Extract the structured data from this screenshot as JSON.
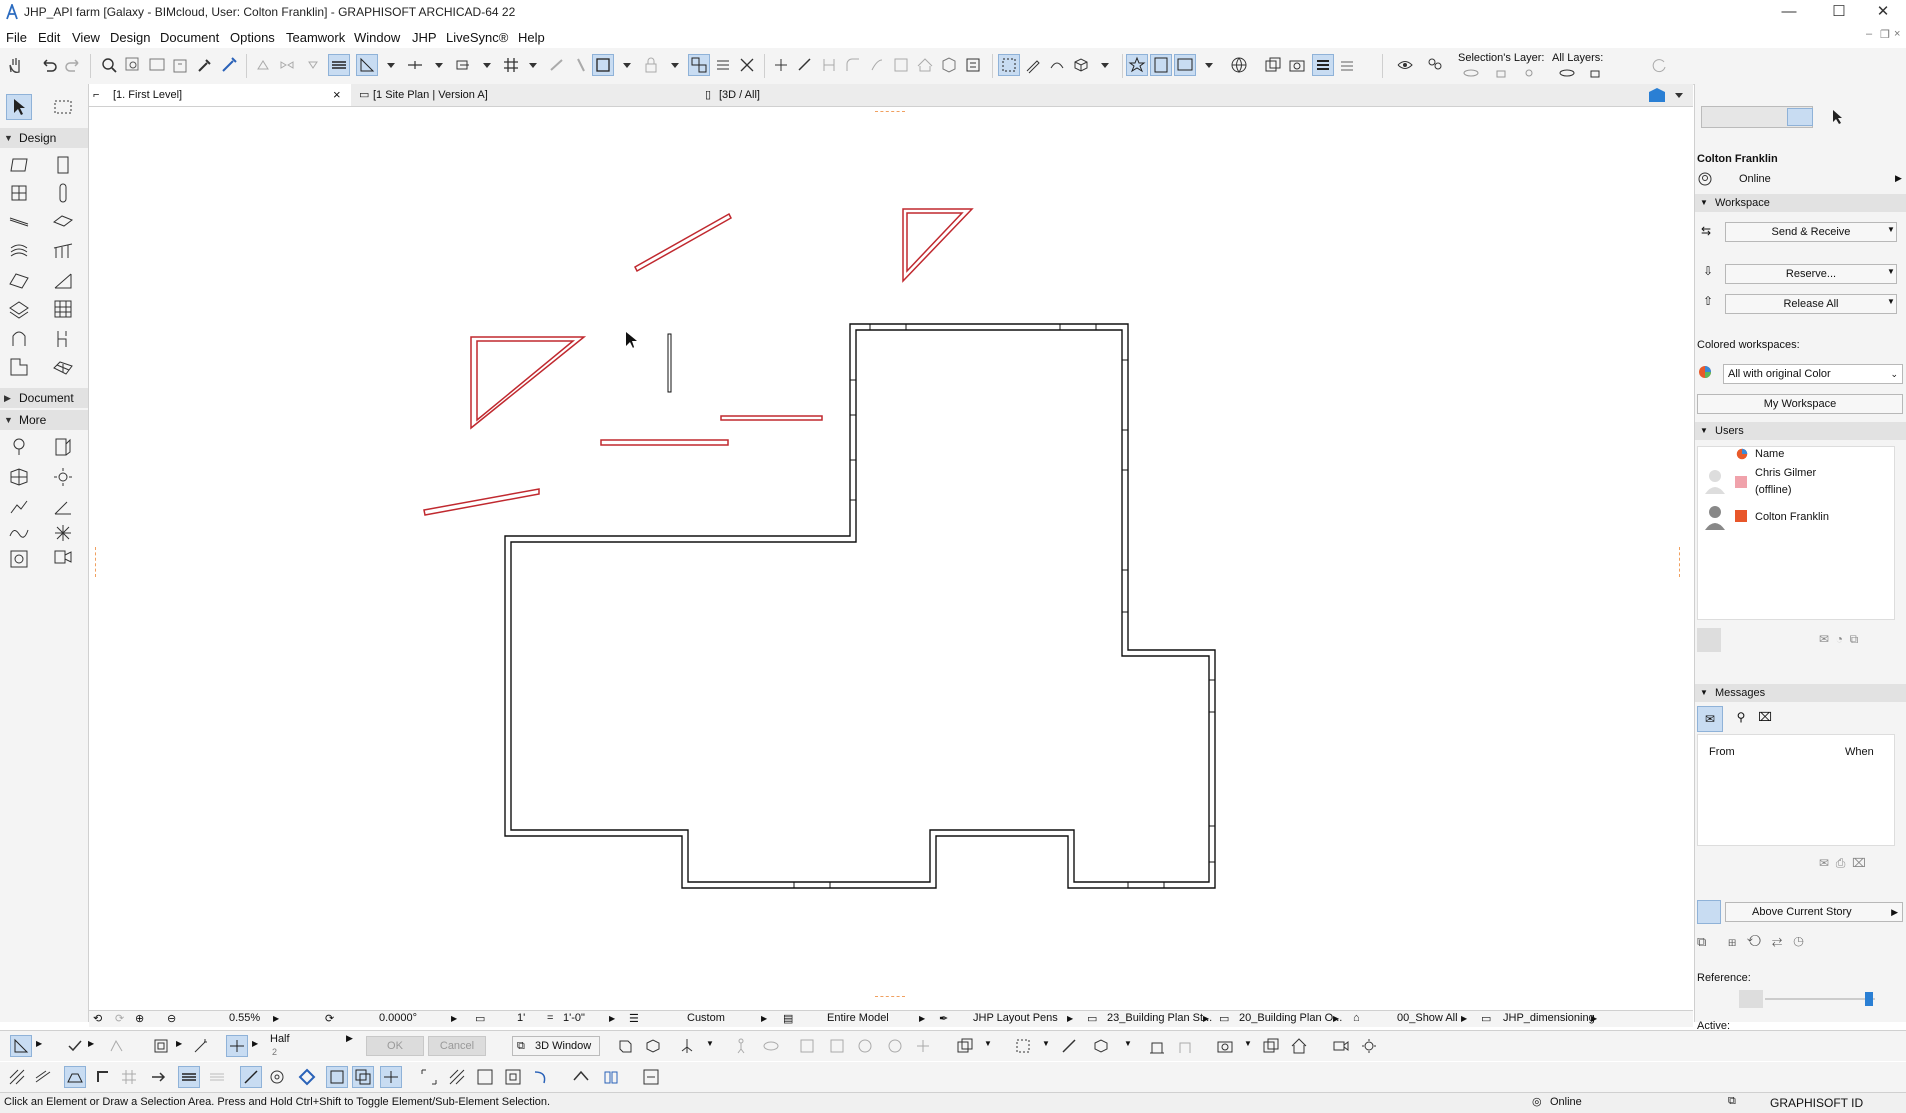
{
  "window": {
    "title": "JHP_API farm [Galaxy - BIMcloud, User: Colton Franklin] - GRAPHISOFT ARCHICAD-64 22",
    "min": "—",
    "max": "☐",
    "close": "✕"
  },
  "menu": [
    "File",
    "Edit",
    "View",
    "Design",
    "Document",
    "Options",
    "Teamwork",
    "Window",
    "JHP",
    "LiveSync®",
    "Help"
  ],
  "toolbar": {
    "selection_layer_label": "Selection's Layer:",
    "all_layers_label": "All Layers:"
  },
  "toolbox": {
    "design": "Design",
    "document": "Document",
    "more": "More"
  },
  "tabs": [
    {
      "label": "[1. First Level]",
      "close": "×"
    },
    {
      "label": "[1 Site Plan | Version A]"
    },
    {
      "label": "[3D / All]"
    }
  ],
  "panel": {
    "user": "Colton Franklin",
    "status": "Online",
    "workspace": "Workspace",
    "send_receive": "Send & Receive",
    "reserve": "Reserve...",
    "release_all": "Release All",
    "colored_label": "Colored workspaces:",
    "colored_value": "All with original Color",
    "my_workspace": "My Workspace",
    "users": "Users",
    "name_col": "Name",
    "user1_name": "Chris Gilmer",
    "user1_status": "(offline)",
    "user2_name": "Colton Franklin",
    "messages": "Messages",
    "from_col": "From",
    "when_col": "When",
    "trace_value": "Above Current Story",
    "reference": "Reference:",
    "active": "Active:",
    "colors": {
      "user1": "#f0a2ab",
      "user2": "#e8562a"
    }
  },
  "navbar": {
    "zoom": "0.55%",
    "angle": "0.0000°",
    "scale_a": "1'",
    "scale_eq": "=",
    "scale_b": "1'-0\"",
    "layer_combo": "Custom",
    "model_view": "Entire Model",
    "pen_set": "JHP Layout Pens",
    "graphic_override": "23_Building Plan St...",
    "renovation": "20_Building Plan O...",
    "filter": "00_Show All",
    "dimension": "JHP_dimensioning"
  },
  "infobar": {
    "half": "Half",
    "half_num": "2",
    "ok": "OK",
    "cancel": "Cancel",
    "window3d": "3D Window"
  },
  "status": {
    "hint": "Click an Element or Draw a Selection Area. Press and Hold Ctrl+Shift to Toggle Element/Sub-Element Selection.",
    "online": "Online",
    "graphisoft_id": "GRAPHISOFT ID"
  }
}
